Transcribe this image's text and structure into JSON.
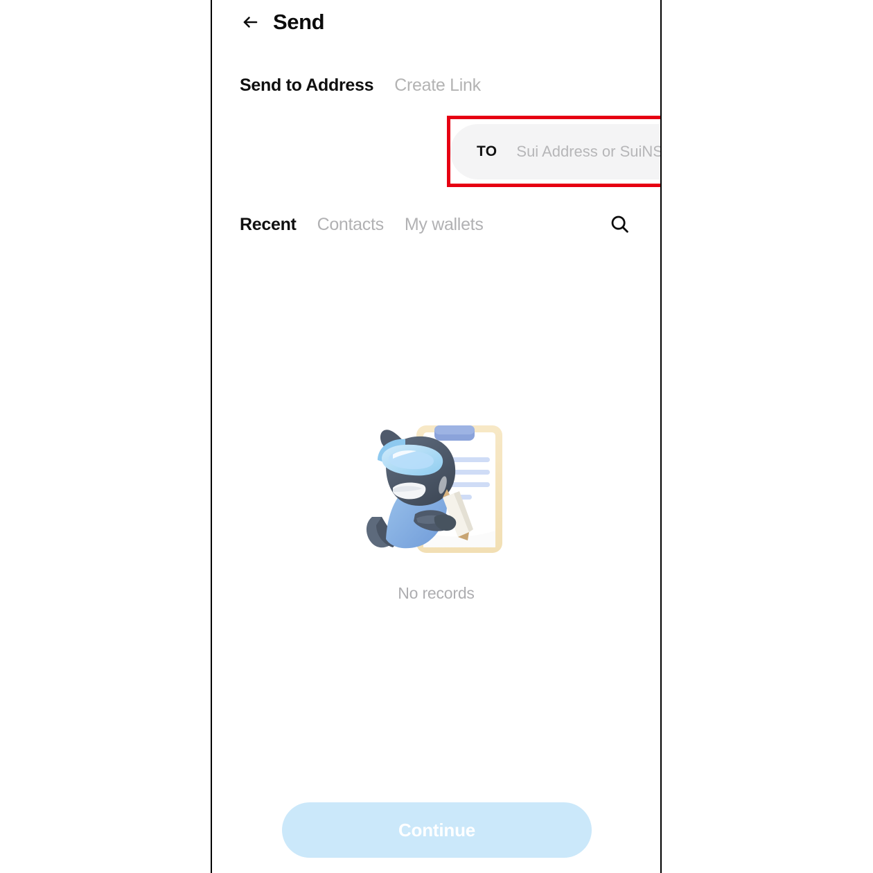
{
  "app": {
    "page_title": "Send",
    "back_icon": "arrow-left-icon"
  },
  "mode_tabs": [
    {
      "label": "Send to Address",
      "active": true
    },
    {
      "label": "Create Link",
      "active": false
    }
  ],
  "recipient_field": {
    "label": "TO",
    "value": "",
    "placeholder": "Sui Address or SuiNS",
    "trailing_icon": "scan-address-icon",
    "highlight_color": "#e60012",
    "background_color": "#f4f4f5"
  },
  "list_tabs": [
    {
      "label": "Recent",
      "active": true
    },
    {
      "label": "Contacts",
      "active": false
    },
    {
      "label": "My wallets",
      "active": false
    }
  ],
  "search": {
    "icon": "search-icon"
  },
  "empty_state": {
    "illustration": "whale-with-clipboard-illustration",
    "message": "No records"
  },
  "footer": {
    "continue_label": "Continue",
    "continue_enabled": false,
    "continue_color": "#cbe8fa",
    "continue_text_color": "#ffffff"
  }
}
